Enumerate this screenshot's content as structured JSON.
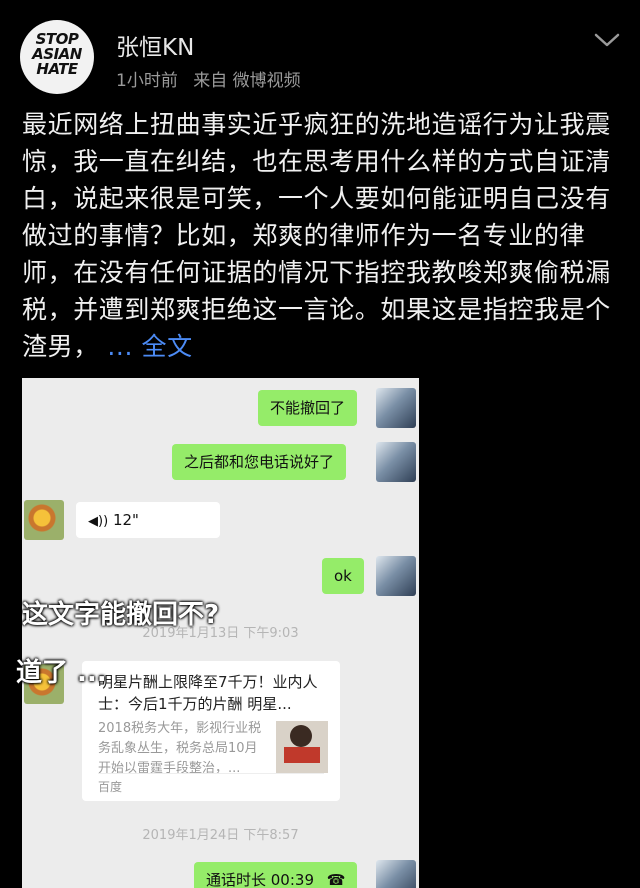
{
  "header": {
    "avatar_text": [
      "STOP",
      "ASIAN",
      "HATE"
    ],
    "username": "张恒KN",
    "time": "1小时前",
    "source": "来自 微博视频"
  },
  "post": {
    "text": "最近网络上扭曲事实近乎疯狂的洗地造谣行为让我震惊，我一直在纠结，也在思考用什么样的方式自证清白，说起来很是可笑，一个人要如何能证明自己没有做过的事情？比如，郑爽的律师作为一名专业的律师，在没有任何证据的情况下指控我教唆郑爽偷税漏税，并遭到郑爽拒绝这一言论。如果这是指控我是个渣男，",
    "more": " ... 全文"
  },
  "chat": {
    "msg1": "不能撤回了",
    "msg2": "之后都和您电话说好了",
    "voice": "12\"",
    "msg3": "ok",
    "stamp1": "2019年1月13日 下午9:03",
    "stamp2": "2019年1月24日 下午8:57",
    "call": "通话时长 00:39",
    "card_title": "明星片酬上限降至7千万！业内人士：今后1千万的片酬 明星...",
    "card_desc": "2018税务大年，影视行业税务乱象丛生，税务总局10月开始以雷霆手段整治，...",
    "card_source": "百度"
  },
  "overlay": {
    "line1": "这文字能撤回不?",
    "line2": "道了 ..."
  }
}
